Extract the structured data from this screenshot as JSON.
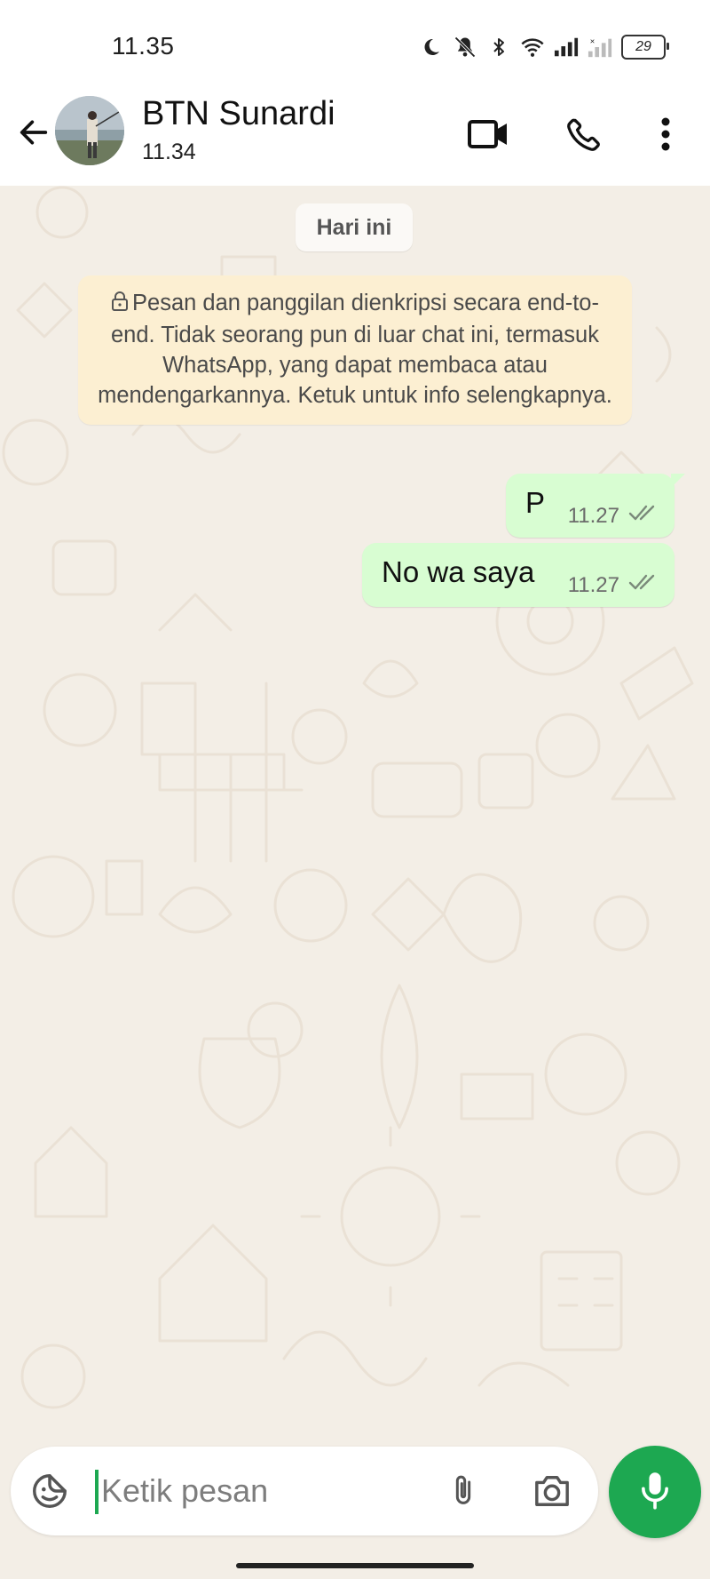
{
  "status_bar": {
    "time": "11.35",
    "battery_level": "29",
    "icons": [
      "moon-icon",
      "bell-off-icon",
      "bluetooth-icon",
      "wifi-icon",
      "signal-icon",
      "signal-off-icon",
      "battery-icon"
    ]
  },
  "header": {
    "contact_name": "BTN Sunardi",
    "last_seen": "11.34",
    "icons": [
      "back-arrow-icon",
      "video-call-icon",
      "phone-icon",
      "more-vert-icon"
    ]
  },
  "chat": {
    "date_chip": "Hari ini",
    "encryption_notice": "Pesan dan panggilan dienkripsi secara end-to-end. Tidak seorang pun di luar chat ini, termasuk WhatsApp, yang dapat membaca atau mendengarkannya. Ketuk untuk info selengkapnya.",
    "messages": [
      {
        "text": "P",
        "time": "11.27",
        "status": "read"
      },
      {
        "text": "No wa saya",
        "time": "11.27",
        "status": "read"
      }
    ]
  },
  "composer": {
    "placeholder": "Ketik pesan",
    "value": "",
    "icons": [
      "sticker-icon",
      "paperclip-icon",
      "camera-icon",
      "mic-icon"
    ]
  },
  "colors": {
    "accent": "#1da851",
    "outgoing_bubble": "#d8fdd2",
    "notice_bg": "#fcefd2",
    "chat_bg": "#f3eee6",
    "tick": "#7a8a7a"
  }
}
